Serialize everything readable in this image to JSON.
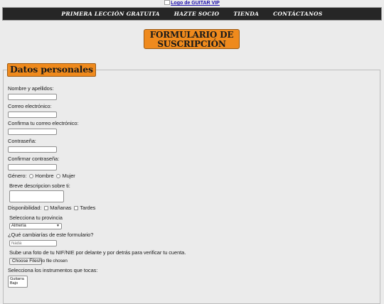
{
  "header": {
    "logo_alt": "Logo de GUITAR VIP",
    "logo_icon": "broken-image-icon"
  },
  "nav": {
    "items": [
      "PRIMERA LECCIÓN GRATUITA",
      "HAZTE SOCIO",
      "TIENDA",
      "CONTÁCTANOS"
    ]
  },
  "page": {
    "title": "FORMULARIO DE SUSCRIPCIÓN"
  },
  "form": {
    "legend": "Datos personales",
    "name_label": "Nombre y apellidos:",
    "email_label": "Correo electrónico:",
    "email_confirm_label": "Confirma tu correo electrónico:",
    "password_label": "Contraseña:",
    "password_confirm_label": "Confirmar contraseña:",
    "gender_label": "Género:",
    "gender_options": [
      "Hombre",
      "Mujer"
    ],
    "description_label": "Breve descripcion sobre ti:",
    "availability_label": "Disponibilidad:",
    "availability_options": [
      "Mañanas",
      "Tardes"
    ],
    "province_label": "Selecciona tu provincia",
    "province_value": "Almería",
    "change_label": "¿Qué cambiarías de este formulario?",
    "change_placeholder": "Nada",
    "upload_label": "Sube una foto de tu NIF/NIE por delante y por detrás para verificar tu cuenta.",
    "upload_button": "Choose Files",
    "upload_status": "No file chosen",
    "instruments_label": "Selecciona los instrumentos que tocas:",
    "instruments_options": [
      "Guitarra",
      "Bajo"
    ]
  }
}
